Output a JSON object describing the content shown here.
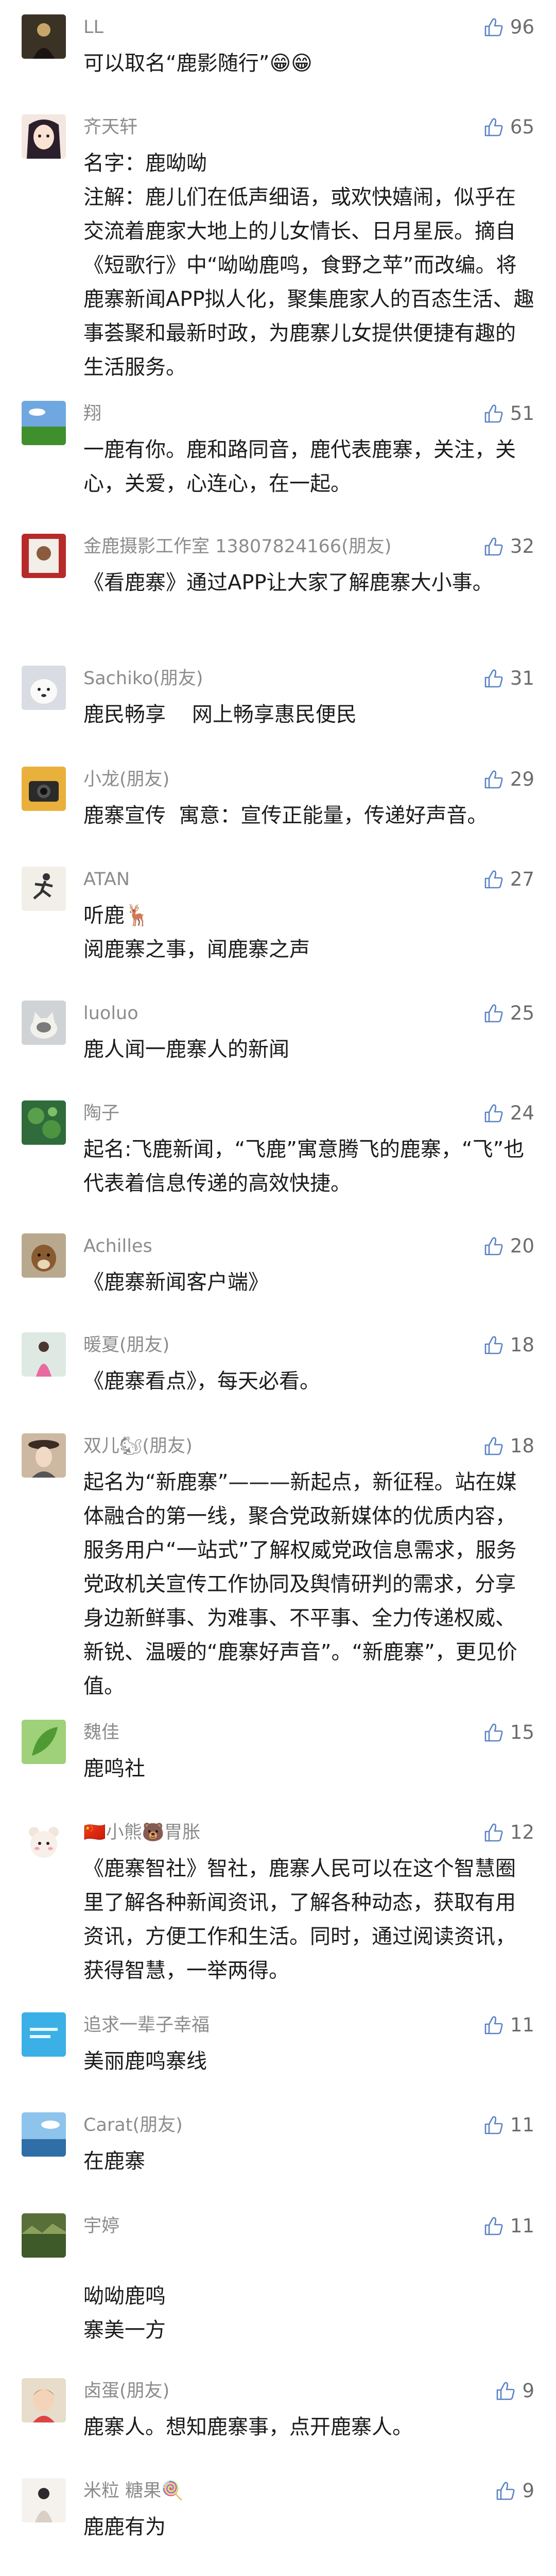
{
  "comments": [
    {
      "name": "LL",
      "text": "可以取名“鹿影随行”😁😁",
      "likes": "96",
      "avatar": "dark-figure"
    },
    {
      "name": "齐天轩",
      "text": "名字：鹿呦呦\n注解：鹿儿们在低声细语，或欢快嬉闹，似乎在交流着鹿家大地上的儿女情长、日月星辰。摘自《短歌行》中“呦呦鹿鸣，食野之苹”而改编。将鹿寨新闻APP拟人化，聚集鹿家人的百态生活、趣事荟聚和最新时政，为鹿寨儿女提供便捷有趣的生活服务。",
      "likes": "65",
      "avatar": "anime-girl"
    },
    {
      "name": "翔",
      "text": "一鹿有你。鹿和路同音，鹿代表鹿寨，关注，关心，关爱，心连心，在一起。",
      "likes": "51",
      "avatar": "grass-sky"
    },
    {
      "name": "金鹿摄影工作室 13807824166(朋友)",
      "text": "《看鹿寨》通过APP让大家了解鹿寨大小事。",
      "likes": "32",
      "avatar": "red-photo"
    },
    {
      "name": "Sachiko(朋友)",
      "text": "鹿民畅享    网上畅享惠民便民",
      "likes": "31",
      "avatar": "white-dog"
    },
    {
      "name": "小龙(朋友)",
      "text": "鹿寨宣传  寓意：宣传正能量，传递好声音。",
      "likes": "29",
      "avatar": "camera"
    },
    {
      "name": "ATAN",
      "text": "听鹿🦌\n阅鹿寨之事，闻鹿寨之声",
      "likes": "27",
      "avatar": "runner"
    },
    {
      "name": "luoluo",
      "text": "鹿人闻一鹿寨人的新闻",
      "likes": "25",
      "avatar": "cat"
    },
    {
      "name": "陶子",
      "text": "起名:飞鹿新闻，“飞鹿”寓意腾飞的鹿寨，“飞”也代表着信息传递的高效快捷。",
      "likes": "24",
      "avatar": "lotus"
    },
    {
      "name": "Achilles",
      "text": "《鹿寨新闻客户端》",
      "likes": "20",
      "avatar": "brown-dog"
    },
    {
      "name": "暖夏(朋友)",
      "text": "《鹿寨看点》，每天必看。",
      "likes": "18",
      "avatar": "pink-figure"
    },
    {
      "name": "双儿🐿(朋友)",
      "text": "起名为“新鹿寨”———新起点，新征程。站在媒体融合的第一线，聚合党政新媒体的优质内容，服务用户“一站式”了解权威党政信息需求，服务党政机关宣传工作协同及舆情研判的需求，分享身边新鲜事、为难事、不平事、全力传递权威、新锐、温暖的“鹿寨好声音”。“新鹿寨”，更见价值。",
      "likes": "18",
      "avatar": "girl-hat"
    },
    {
      "name": "魏佳",
      "text": "鹿鸣社",
      "likes": "15",
      "avatar": "green-leaf"
    },
    {
      "name": "🇨🇳小熊🐻胃胀",
      "text": "《鹿寨智社》智社，鹿寨人民可以在这个智慧圈里了解各种新闻资讯，了解各种动态，获取有用资讯，方便工作和生活。同时，通过阅读资讯，获得智慧，一举两得。",
      "likes": "12",
      "avatar": "cartoon-bear"
    },
    {
      "name": "追求一辈子幸福",
      "text": "美丽鹿鸣寨线",
      "likes": "11",
      "avatar": "blue-text"
    },
    {
      "name": "Carat(朋友)",
      "text": "在鹿寨",
      "likes": "11",
      "avatar": "sky-sea"
    },
    {
      "name": "宇婷",
      "text": "\n呦呦鹿鸣\n寨美一方",
      "likes": "11",
      "avatar": "green-field"
    },
    {
      "name": "卤蛋(朋友)",
      "text": "鹿寨人。想知鹿寨事，点开鹿寨人。",
      "likes": "9",
      "avatar": "child"
    },
    {
      "name": "米粒    糖果🍭",
      "text": "鹿鹿有为",
      "likes": "9",
      "avatar": "pale-figure"
    }
  ]
}
